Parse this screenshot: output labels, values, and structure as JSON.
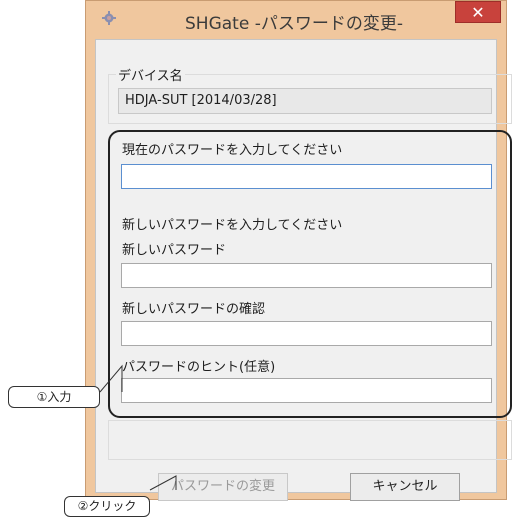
{
  "window": {
    "title": "SHGate -パスワードの変更-",
    "close_glyph": "✕"
  },
  "device": {
    "legend": "デバイス名",
    "value": "HDJA-SUT [2014/03/28]"
  },
  "current_password": {
    "legend": "現在のパスワードを入力してください",
    "value": ""
  },
  "new_password_group": {
    "legend": "新しいパスワードを入力してください",
    "new_password_label": "新しいパスワード",
    "confirm_label": "新しいパスワードの確認",
    "hint_label": "パスワードのヒント(任意)"
  },
  "buttons": {
    "change_label": "パスワードの変更",
    "cancel_label": "キャンセル"
  },
  "callouts": {
    "input": "①入力",
    "click": "②クリック"
  },
  "colors": {
    "window_frame": "#f0c79e",
    "close_button": "#c8423c",
    "focus_border": "#5b8fd0"
  }
}
